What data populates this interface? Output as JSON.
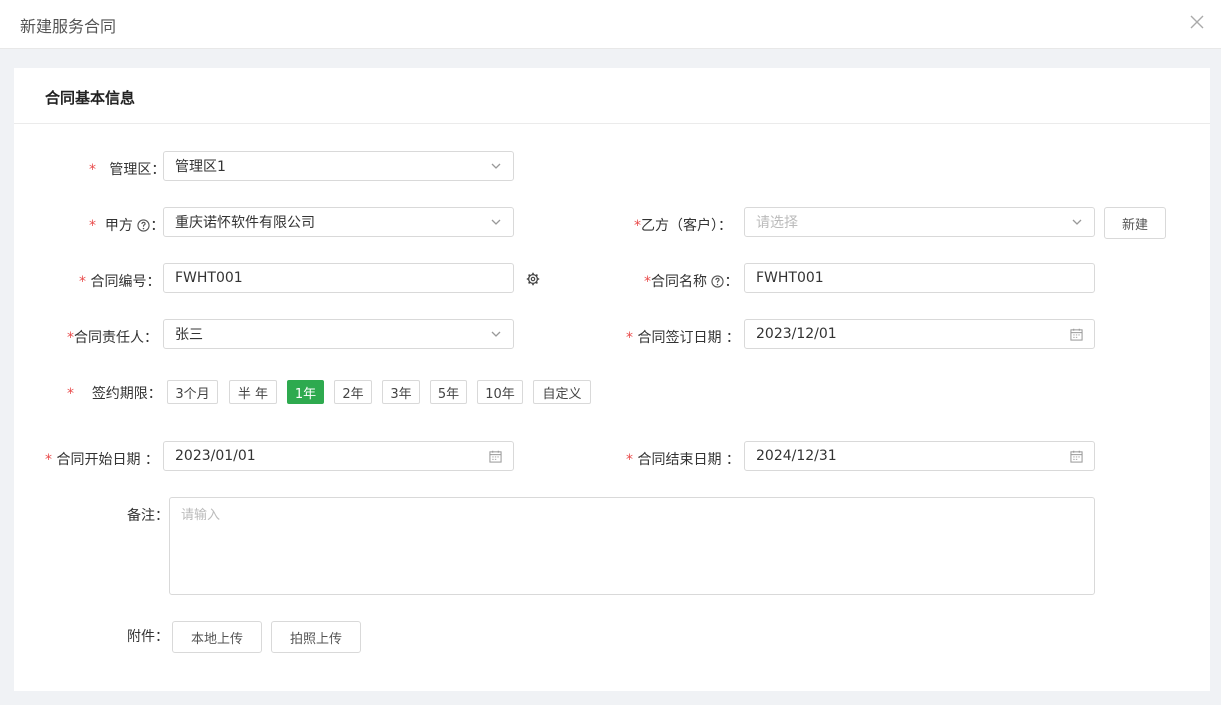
{
  "dialog": {
    "title": "新建服务合同"
  },
  "section": {
    "title": "合同基本信息"
  },
  "form": {
    "required_mark": "*",
    "admin_area": {
      "label": "管理区：",
      "value": "管理区1"
    },
    "party_a": {
      "label": "甲方",
      "colon": "：",
      "value": "重庆诺怀软件有限公司"
    },
    "party_b": {
      "label": "乙方（客户）：",
      "placeholder": "请选择",
      "new_button": "新建"
    },
    "contract_no": {
      "label": "合同编号：",
      "value": "FWHT001"
    },
    "contract_name": {
      "label": "合同名称",
      "colon": "：",
      "value": "FWHT001"
    },
    "owner": {
      "label": "合同责任人：",
      "value": "张三"
    },
    "sign_date": {
      "label": "合同签订日期 ：",
      "value": "2023/12/01"
    },
    "term": {
      "label": "签约期限：",
      "options": [
        "3个月",
        "半 年",
        "1年",
        "2年",
        "3年",
        "5年",
        "10年",
        "自定义"
      ],
      "selected": "1年"
    },
    "start_date": {
      "label": "合同开始日期 ：",
      "value": "2023/01/01"
    },
    "end_date": {
      "label": "合同结束日期 ：",
      "value": "2024/12/31"
    },
    "remark": {
      "label": "备注：",
      "placeholder": "请输入"
    },
    "attachment": {
      "label": "附件：",
      "local_upload": "本地上传",
      "photo_upload": "拍照上传"
    }
  },
  "colors": {
    "accent": "#2eaa4f",
    "required": "#e94b4b"
  },
  "icons": [
    "close-icon",
    "chevron-down-icon",
    "help-icon",
    "gear-icon",
    "calendar-icon"
  ]
}
